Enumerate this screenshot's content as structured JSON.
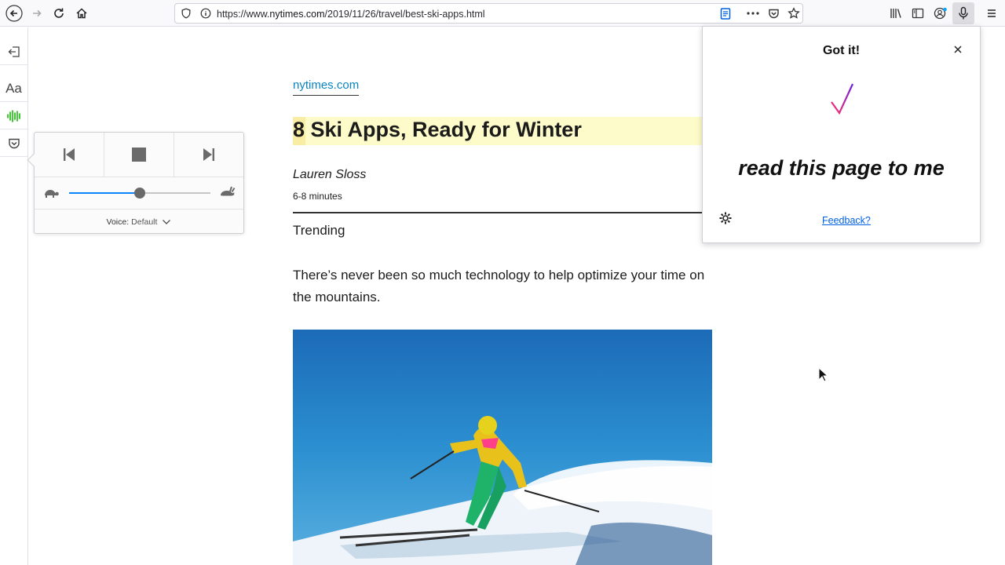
{
  "browser": {
    "url_prefix": "https://www.",
    "url_host": "nytimes.com",
    "url_path": "/2019/11/26/travel/best-ski-apps.html"
  },
  "icons": {
    "back": "back-arrow-icon",
    "forward": "forward-arrow-icon",
    "reload": "reload-icon",
    "home": "home-icon",
    "tracking": "shield-icon",
    "info": "info-icon",
    "reader": "reader-view-icon",
    "more": "more-dots-icon",
    "pocket": "pocket-icon",
    "bookmark": "star-icon",
    "library": "library-icon",
    "sidebar": "sidebar-icon",
    "account": "account-icon",
    "voice": "microphone-icon",
    "menu": "hamburger-menu-icon"
  },
  "reader_sidebar": {
    "type_controls_label": "Aa"
  },
  "narrate": {
    "voice_label": "Voice:",
    "voice_value": "Default",
    "speed_fraction": 0.5
  },
  "article": {
    "domain": "nytimes.com",
    "title": "8 Ski Apps, Ready for Winter",
    "author": "Lauren Sloss",
    "read_time": "6-8 minutes",
    "section": "Trending",
    "intro": "There’s never been so much technology to help optimize your time on the mountains."
  },
  "voice_popup": {
    "status": "Got it!",
    "phrase": "read this page to me",
    "feedback": "Feedback?"
  },
  "colors": {
    "link": "#0a84c1",
    "highlight": "#fdfbc9",
    "active_narrate": "#12bc00",
    "feedback_link": "#0060df"
  }
}
